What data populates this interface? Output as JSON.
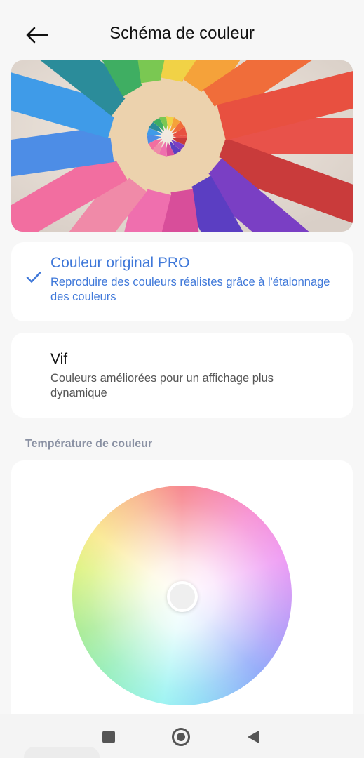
{
  "header": {
    "title": "Schéma de couleur",
    "back_icon": "arrow-left-icon"
  },
  "hero_image": {
    "subject": "colored-pencils-circle"
  },
  "options": [
    {
      "title": "Couleur original PRO",
      "description": "Reproduire des couleurs réalistes grâce à l'étalonnage des couleurs",
      "selected": true,
      "icon": "checkmark-icon"
    },
    {
      "title": "Vif",
      "description": "Couleurs améliorées pour un affichage plus dynamique",
      "selected": false
    }
  ],
  "temperature": {
    "section_label": "Température de couleur",
    "accent": "#3f78d9"
  },
  "nav": {
    "recent_icon": "square-icon",
    "home_icon": "circle-home-icon",
    "back_icon": "triangle-back-icon"
  }
}
